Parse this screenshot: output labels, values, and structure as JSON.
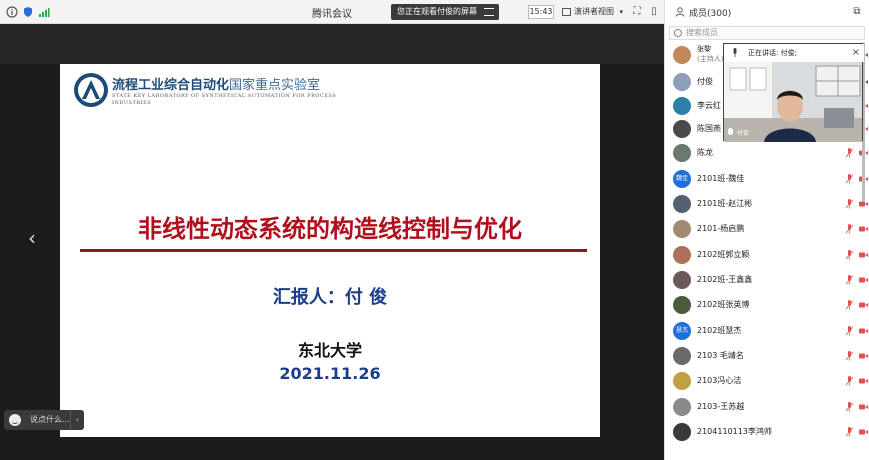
{
  "topbar": {
    "meeting_title": "腾讯会议",
    "watching_label": "您正在观看付俊的屏幕",
    "time": "15:43",
    "view_mode": "演讲者视图"
  },
  "slide": {
    "lab_name_cn": "流程工业综合自动化",
    "lab_name_cn_suffix": "国家重点实验室",
    "lab_name_en": "STATE KEY LABORATORY OF SYNTHETICAL AUTOMATION FOR PROCESS INDUSTRIES",
    "title": "非线性动态系统的构造线控制与优化",
    "reporter": "汇报人：付 俊",
    "university": "东北大学",
    "date": "2021.11.26"
  },
  "chat": {
    "placeholder": "说点什么..."
  },
  "panel": {
    "members_label": "成员(300)",
    "search_placeholder": "搜索成员",
    "speaking_label": "正在讲话: 付俊;",
    "speaker_name": "付俊",
    "members": [
      {
        "name": "张黎",
        "sub": "(主持人)",
        "avatar": "#c08a5a",
        "mic_color": "#666",
        "cam_color": "#666"
      },
      {
        "name": "付俊",
        "avatar": "#8da0b8",
        "mic_color": "#666",
        "cam_color": "#666"
      },
      {
        "name": "李云红",
        "avatar": "#2c7fa8",
        "mic_color": "#e05050",
        "cam_color": "#e05050"
      },
      {
        "name": "陈国燕",
        "avatar": "#4a4a4a",
        "mic_color": "#e05050",
        "cam_color": "#e05050"
      },
      {
        "name": "陈龙",
        "avatar": "#6a7a6a",
        "mic_color": "#e05050",
        "cam_color": "#e05050"
      },
      {
        "name": "2101班-魏佳",
        "avatar": "#1e6fd9",
        "avatar_text": "魏佳",
        "mic_color": "#e05050",
        "cam_color": "#e05050"
      },
      {
        "name": "2101班-赵江彬",
        "avatar": "#556070",
        "mic_color": "#e05050",
        "cam_color": "#e05050"
      },
      {
        "name": "2101-杨启鹏",
        "avatar": "#a08a70",
        "mic_color": "#e05050",
        "cam_color": "#e05050"
      },
      {
        "name": "2102班郭立颖",
        "avatar": "#b0705a",
        "mic_color": "#e05050",
        "cam_color": "#e05050"
      },
      {
        "name": "2102班-王鑫鑫",
        "avatar": "#6a5a5a",
        "mic_color": "#e05050",
        "cam_color": "#e05050"
      },
      {
        "name": "2102班张英博",
        "avatar": "#4a5a3a",
        "mic_color": "#e05050",
        "cam_color": "#e05050"
      },
      {
        "name": "2102班慧杰",
        "avatar": "#1e6fd9",
        "avatar_text": "慧杰",
        "mic_color": "#e05050",
        "cam_color": "#e05050"
      },
      {
        "name": "2103 毛靖名",
        "avatar": "#6a6a6a",
        "mic_color": "#e05050",
        "cam_color": "#e05050"
      },
      {
        "name": "2103冯心洁",
        "avatar": "#c0a040",
        "mic_color": "#e05050",
        "cam_color": "#e05050"
      },
      {
        "name": "2103-王苏越",
        "avatar": "#8a8a8a",
        "mic_color": "#e05050",
        "cam_color": "#e05050"
      },
      {
        "name": "2104110113李鸿帅",
        "avatar": "#3a3a3a",
        "mic_color": "#e05050",
        "cam_color": "#e05050"
      }
    ]
  },
  "colors": {
    "slide_title": "#b0101e",
    "slide_accent": "#1c3c8c",
    "muted_icon": "#e05050"
  }
}
